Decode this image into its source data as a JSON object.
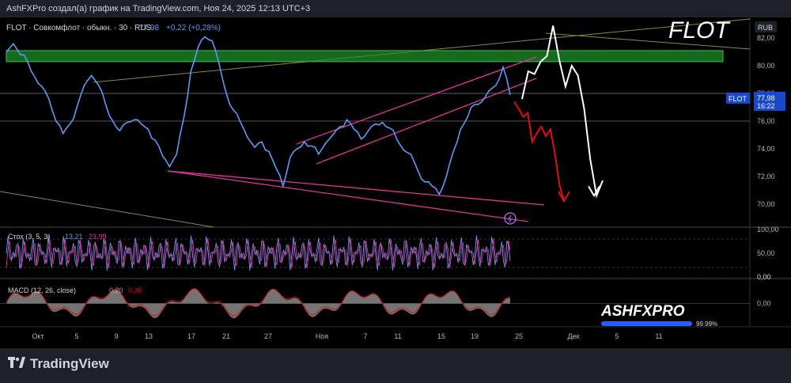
{
  "header": {
    "caption": "AshFXPro создал(а) график на TradingView.com, Ноя 24, 2025 12:13 UTC+3"
  },
  "symbol_bar": {
    "name": "FLOT · Совкомфлот · обыкн. · 30 · RUS",
    "last": "77,98",
    "change": "+0,22 (+0,28%)"
  },
  "big_title": "FLOT",
  "currency": "RUB",
  "price_tag": {
    "symbol": "FLOT",
    "price": "77,98",
    "time": "16:22"
  },
  "stoch_label": {
    "name": "Стох (3, 5, 3)",
    "k": "13,21",
    "d": "23,99"
  },
  "macd_label": {
    "name": "MACD (12, 26, close)",
    "macd": "0,20",
    "signal": "0,38"
  },
  "brand": {
    "name": "ASHFXPRO",
    "progress_text": "99.99%",
    "progress": 0.9999
  },
  "footer": {
    "logo": "TradingView"
  },
  "colors": {
    "price": "#5b9cf6",
    "support_zone": "#1e8f2a",
    "channel": "#e0359a",
    "bear_path": "#e01010",
    "alt_path": "#ffffff",
    "stoch_k": "#5b9cf6",
    "stoch_d": "#e0359a",
    "macd_hist": "#a5a5a5",
    "macd_line": "#e01010"
  },
  "chart_data": [
    {
      "type": "line",
      "title": "FLOT · Совкомфлот · обыкн. · 30 · RUS",
      "ylabel": "RUB",
      "ylim": [
        68.5,
        83.5
      ],
      "y_ticks": [
        "82,00",
        "80,00",
        "78,00",
        "76,00",
        "74,00",
        "72,00",
        "70,00"
      ],
      "x_ticks": [
        "Окт",
        "5",
        "9",
        "13",
        "17",
        "21",
        "27",
        "Ноя",
        "7",
        "11",
        "15",
        "19",
        "25",
        "Дек",
        "5",
        "11"
      ],
      "series": [
        {
          "values": [
            81.0,
            81.6,
            80.8,
            80.3,
            79.2,
            78.5,
            77.6,
            76.0,
            75.1,
            75.8,
            77.1,
            78.6,
            79.3,
            78.6,
            77.2,
            76.0,
            75.3,
            75.9,
            76.1,
            75.8,
            75.4,
            74.6,
            73.5,
            72.7,
            73.6,
            76.2,
            79.6,
            81.3,
            82.1,
            81.8,
            80.1,
            78.0,
            76.8,
            75.9,
            74.8,
            74.1,
            74.5,
            73.8,
            72.6,
            71.3,
            73.4,
            74.0,
            74.5,
            74.2,
            73.6,
            74.4,
            75.0,
            75.6,
            76.1,
            75.4,
            74.7,
            75.3,
            75.8,
            75.9,
            75.5,
            74.7,
            73.9,
            73.6,
            72.4,
            71.6,
            71.3,
            70.7,
            72.0,
            73.8,
            75.4,
            76.3,
            77.2,
            77.4,
            78.2,
            78.6,
            79.9,
            77.9
          ]
        }
      ],
      "annotations": {
        "support_zone": [
          80.3,
          81.1
        ],
        "horizontal_levels": [
          78.0,
          76.0
        ],
        "projection_bearish": [
          77.4,
          76.9,
          76.3,
          76.6,
          74.5,
          75.1,
          75.6,
          74.9,
          75.4,
          73.7,
          71.4,
          70.2
        ],
        "projection_alternative": [
          77.6,
          79.6,
          79.4,
          80.3,
          80.7,
          82.9,
          80.4,
          78.5,
          80.0,
          79.3,
          76.9,
          73.2,
          70.6,
          71.7
        ]
      }
    },
    {
      "type": "line",
      "title": "Стох (3, 5, 3)",
      "ylim": [
        0,
        100
      ],
      "y_ticks": [
        "100,00",
        "50,00",
        "0,00"
      ],
      "series": [
        {
          "name": "%K",
          "values": []
        },
        {
          "name": "%D",
          "values": []
        }
      ]
    },
    {
      "type": "bar",
      "title": "MACD (12, 26, close)",
      "ylim": [
        -0.6,
        0.6
      ],
      "y_ticks": [
        "0,00"
      ],
      "series": [
        {
          "name": "Histogram",
          "values": []
        },
        {
          "name": "MACD",
          "values": []
        }
      ]
    }
  ]
}
